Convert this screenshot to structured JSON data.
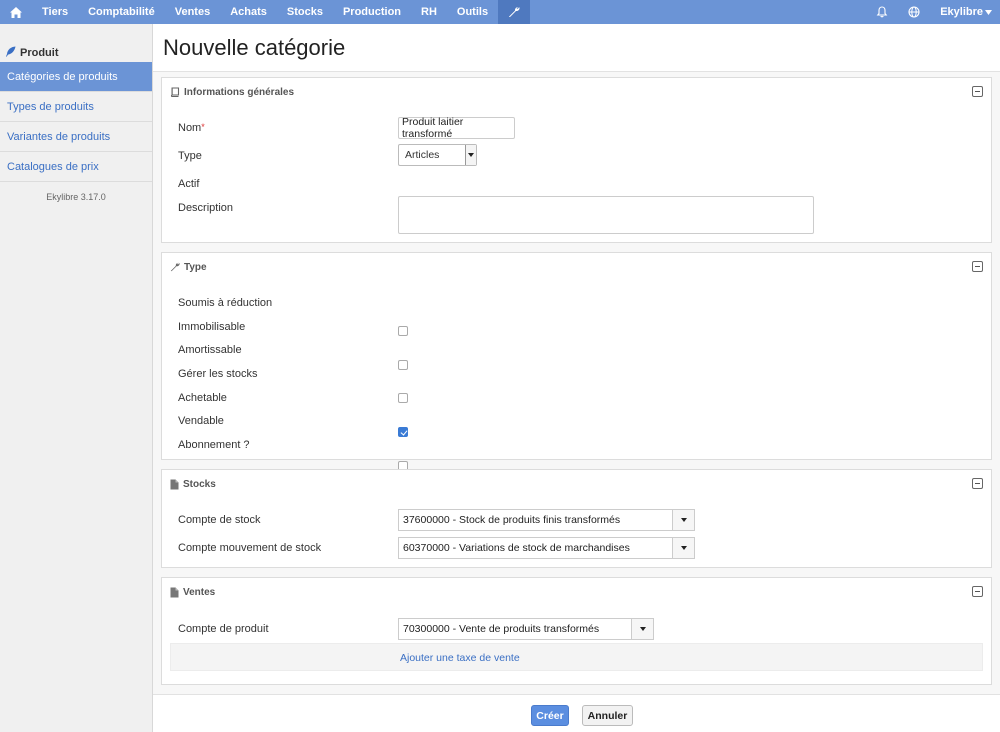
{
  "nav": {
    "items": [
      "Tiers",
      "Comptabilité",
      "Ventes",
      "Achats",
      "Stocks",
      "Production",
      "RH",
      "Outils"
    ],
    "user": "Ekylibre"
  },
  "sidebar": {
    "title": "Produit",
    "items": [
      {
        "label": "Catégories de produits",
        "active": true
      },
      {
        "label": "Types de produits",
        "active": false
      },
      {
        "label": "Variantes de produits",
        "active": false
      },
      {
        "label": "Catalogues de prix",
        "active": false
      }
    ],
    "version": "Ekylibre 3.17.0"
  },
  "page": {
    "title": "Nouvelle catégorie"
  },
  "general": {
    "heading": "Informations générales",
    "name_label": "Nom",
    "required_mark": "*",
    "name_value": "Produit laitier transformé",
    "type_label": "Type",
    "type_value": "Articles",
    "active_label": "Actif",
    "active_checked": true,
    "description_label": "Description"
  },
  "type_section": {
    "heading": "Type",
    "options": [
      {
        "label": "Soumis à réduction",
        "checked": false
      },
      {
        "label": "Immobilisable",
        "checked": false
      },
      {
        "label": "Amortissable",
        "checked": false
      },
      {
        "label": "Gérer les stocks",
        "checked": true
      },
      {
        "label": "Achetable",
        "checked": false
      },
      {
        "label": "Vendable",
        "checked": true
      },
      {
        "label": "Abonnement ?",
        "checked": false
      }
    ]
  },
  "stocks": {
    "heading": "Stocks",
    "stock_account_label": "Compte de stock",
    "stock_account_value": "37600000 - Stock de produits finis transformés",
    "movement_account_label": "Compte mouvement de stock",
    "movement_account_value": "60370000 - Variations de stock de marchandises"
  },
  "sales": {
    "heading": "Ventes",
    "product_account_label": "Compte de produit",
    "product_account_value": "70300000 - Vente de produits transformés",
    "add_tax_link": "Ajouter une taxe de vente"
  },
  "footer": {
    "create_label": "Créer",
    "cancel_label": "Annuler"
  }
}
